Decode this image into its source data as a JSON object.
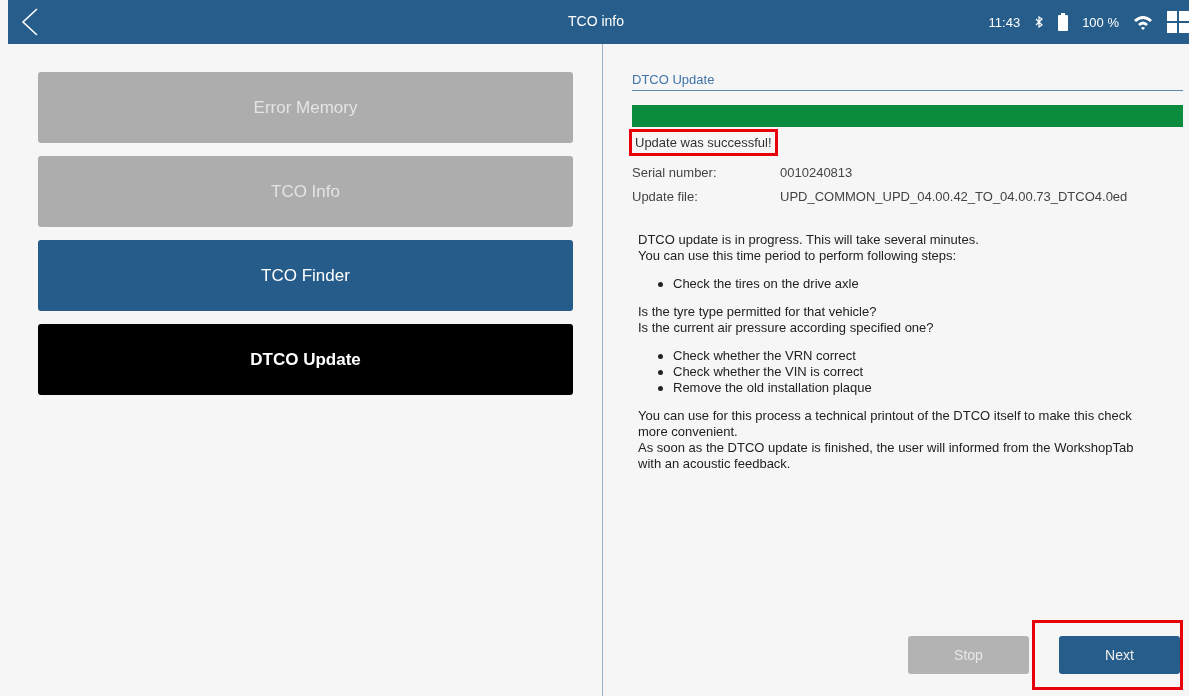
{
  "top_bar": {
    "title": "TCO info",
    "time": "11:43",
    "battery": "100 %"
  },
  "menu": [
    {
      "label": "Error Memory",
      "disabled": true,
      "selected": false
    },
    {
      "label": "TCO Info",
      "disabled": true,
      "selected": false
    },
    {
      "label": "TCO Finder",
      "disabled": false,
      "selected": false
    },
    {
      "label": "DTCO Update",
      "disabled": false,
      "selected": true
    }
  ],
  "panel": {
    "title": "DTCO Update",
    "progress": {
      "level": 1
    },
    "status": {
      "text": "Update was successful!",
      "highlighted": true
    },
    "fields": [
      {
        "label": "Serial number:",
        "value": "0010240813"
      },
      {
        "label": "Update file:",
        "value": "UPD_COMMON_UPD_04.00.42_TO_04.00.73_DTCO4.0ed"
      }
    ],
    "instructions": [
      {
        "kind": "text",
        "lines": [
          "DTCO update is in progress. This will take several minutes.",
          "You can use this time period to perform following steps:"
        ]
      },
      {
        "kind": "bullets",
        "lines": [
          "Check the tires on the drive axle"
        ]
      },
      {
        "kind": "text",
        "lines": [
          "Is the tyre type permitted for that vehicle?",
          "Is the current air pressure according specified one?"
        ]
      },
      {
        "kind": "bullets",
        "lines": [
          "Check whether the VRN correct",
          "Check whether the VIN is correct",
          "Remove the old installation plaque"
        ]
      },
      {
        "kind": "text",
        "lines": [
          "You can use for this process a technical printout of the DTCO itself to make this check more convenient.",
          "As soon as the DTCO update is finished, the user will informed from the WorkshopTab with an acoustic feedback."
        ]
      }
    ],
    "buttons": [
      {
        "label": "Stop",
        "disabled": true,
        "highlighted": false
      },
      {
        "label": "Next",
        "disabled": false,
        "highlighted": true
      }
    ]
  }
}
